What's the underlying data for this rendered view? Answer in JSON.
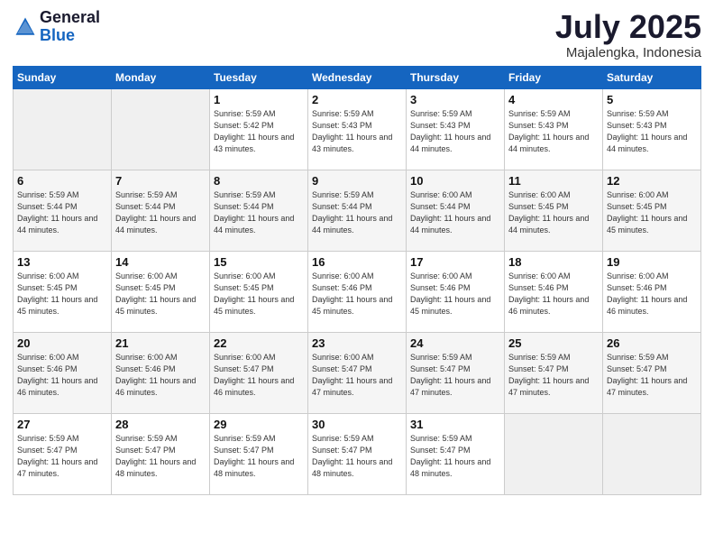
{
  "logo": {
    "general": "General",
    "blue": "Blue"
  },
  "header": {
    "month": "July 2025",
    "location": "Majalengka, Indonesia"
  },
  "weekdays": [
    "Sunday",
    "Monday",
    "Tuesday",
    "Wednesday",
    "Thursday",
    "Friday",
    "Saturday"
  ],
  "weeks": [
    [
      {
        "day": "",
        "info": ""
      },
      {
        "day": "",
        "info": ""
      },
      {
        "day": "1",
        "info": "Sunrise: 5:59 AM\nSunset: 5:42 PM\nDaylight: 11 hours and 43 minutes."
      },
      {
        "day": "2",
        "info": "Sunrise: 5:59 AM\nSunset: 5:43 PM\nDaylight: 11 hours and 43 minutes."
      },
      {
        "day": "3",
        "info": "Sunrise: 5:59 AM\nSunset: 5:43 PM\nDaylight: 11 hours and 44 minutes."
      },
      {
        "day": "4",
        "info": "Sunrise: 5:59 AM\nSunset: 5:43 PM\nDaylight: 11 hours and 44 minutes."
      },
      {
        "day": "5",
        "info": "Sunrise: 5:59 AM\nSunset: 5:43 PM\nDaylight: 11 hours and 44 minutes."
      }
    ],
    [
      {
        "day": "6",
        "info": "Sunrise: 5:59 AM\nSunset: 5:44 PM\nDaylight: 11 hours and 44 minutes."
      },
      {
        "day": "7",
        "info": "Sunrise: 5:59 AM\nSunset: 5:44 PM\nDaylight: 11 hours and 44 minutes."
      },
      {
        "day": "8",
        "info": "Sunrise: 5:59 AM\nSunset: 5:44 PM\nDaylight: 11 hours and 44 minutes."
      },
      {
        "day": "9",
        "info": "Sunrise: 5:59 AM\nSunset: 5:44 PM\nDaylight: 11 hours and 44 minutes."
      },
      {
        "day": "10",
        "info": "Sunrise: 6:00 AM\nSunset: 5:44 PM\nDaylight: 11 hours and 44 minutes."
      },
      {
        "day": "11",
        "info": "Sunrise: 6:00 AM\nSunset: 5:45 PM\nDaylight: 11 hours and 44 minutes."
      },
      {
        "day": "12",
        "info": "Sunrise: 6:00 AM\nSunset: 5:45 PM\nDaylight: 11 hours and 45 minutes."
      }
    ],
    [
      {
        "day": "13",
        "info": "Sunrise: 6:00 AM\nSunset: 5:45 PM\nDaylight: 11 hours and 45 minutes."
      },
      {
        "day": "14",
        "info": "Sunrise: 6:00 AM\nSunset: 5:45 PM\nDaylight: 11 hours and 45 minutes."
      },
      {
        "day": "15",
        "info": "Sunrise: 6:00 AM\nSunset: 5:45 PM\nDaylight: 11 hours and 45 minutes."
      },
      {
        "day": "16",
        "info": "Sunrise: 6:00 AM\nSunset: 5:46 PM\nDaylight: 11 hours and 45 minutes."
      },
      {
        "day": "17",
        "info": "Sunrise: 6:00 AM\nSunset: 5:46 PM\nDaylight: 11 hours and 45 minutes."
      },
      {
        "day": "18",
        "info": "Sunrise: 6:00 AM\nSunset: 5:46 PM\nDaylight: 11 hours and 46 minutes."
      },
      {
        "day": "19",
        "info": "Sunrise: 6:00 AM\nSunset: 5:46 PM\nDaylight: 11 hours and 46 minutes."
      }
    ],
    [
      {
        "day": "20",
        "info": "Sunrise: 6:00 AM\nSunset: 5:46 PM\nDaylight: 11 hours and 46 minutes."
      },
      {
        "day": "21",
        "info": "Sunrise: 6:00 AM\nSunset: 5:46 PM\nDaylight: 11 hours and 46 minutes."
      },
      {
        "day": "22",
        "info": "Sunrise: 6:00 AM\nSunset: 5:47 PM\nDaylight: 11 hours and 46 minutes."
      },
      {
        "day": "23",
        "info": "Sunrise: 6:00 AM\nSunset: 5:47 PM\nDaylight: 11 hours and 47 minutes."
      },
      {
        "day": "24",
        "info": "Sunrise: 5:59 AM\nSunset: 5:47 PM\nDaylight: 11 hours and 47 minutes."
      },
      {
        "day": "25",
        "info": "Sunrise: 5:59 AM\nSunset: 5:47 PM\nDaylight: 11 hours and 47 minutes."
      },
      {
        "day": "26",
        "info": "Sunrise: 5:59 AM\nSunset: 5:47 PM\nDaylight: 11 hours and 47 minutes."
      }
    ],
    [
      {
        "day": "27",
        "info": "Sunrise: 5:59 AM\nSunset: 5:47 PM\nDaylight: 11 hours and 47 minutes."
      },
      {
        "day": "28",
        "info": "Sunrise: 5:59 AM\nSunset: 5:47 PM\nDaylight: 11 hours and 48 minutes."
      },
      {
        "day": "29",
        "info": "Sunrise: 5:59 AM\nSunset: 5:47 PM\nDaylight: 11 hours and 48 minutes."
      },
      {
        "day": "30",
        "info": "Sunrise: 5:59 AM\nSunset: 5:47 PM\nDaylight: 11 hours and 48 minutes."
      },
      {
        "day": "31",
        "info": "Sunrise: 5:59 AM\nSunset: 5:47 PM\nDaylight: 11 hours and 48 minutes."
      },
      {
        "day": "",
        "info": ""
      },
      {
        "day": "",
        "info": ""
      }
    ]
  ]
}
